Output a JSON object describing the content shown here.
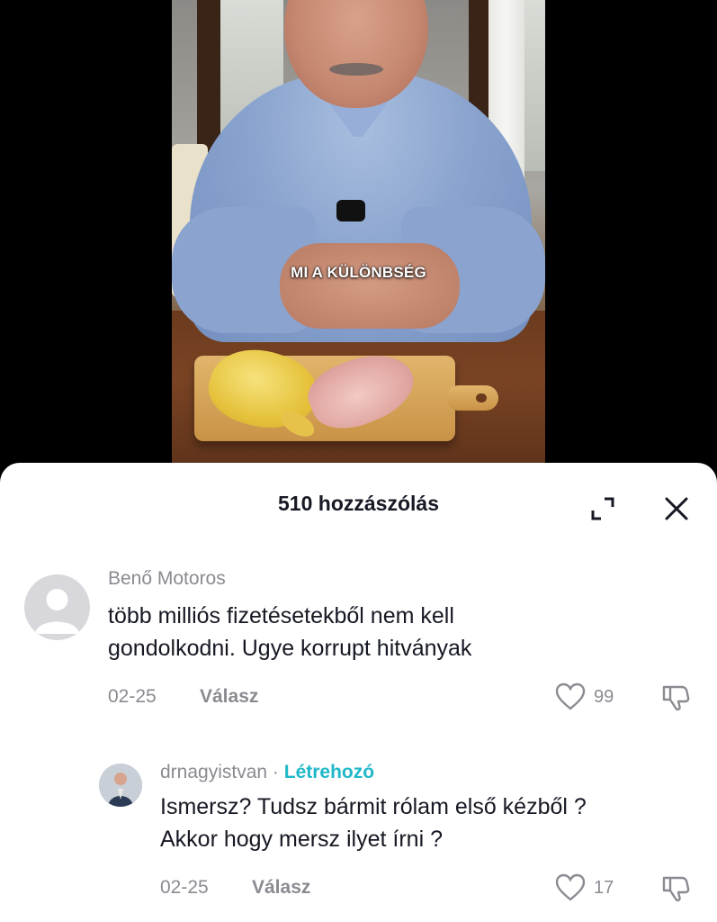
{
  "video": {
    "caption": "MI A KÜLÖNBSÉG"
  },
  "sheet": {
    "title": "510 hozzászólás",
    "icons": {
      "expand": "expand-icon",
      "close": "close-icon"
    }
  },
  "comments": [
    {
      "username": "Benő Motoros",
      "text_line1": "több milliós fizetésetekből nem kell",
      "text_line2": "gondolkodni. Ugye korrupt hitványak",
      "date": "02-25",
      "reply_label": "Válasz",
      "likes": "99",
      "avatar": "default-avatar"
    },
    {
      "username": "drnagyistvan",
      "separator": " · ",
      "badge": "Létrehozó",
      "text_line1": "Ismersz? Tudsz bármit rólam első kézből ?",
      "text_line2": "Akkor hogy mersz ilyet írni ?",
      "date": "02-25",
      "reply_label": "Válasz",
      "likes": "17",
      "avatar": "profile-photo"
    }
  ],
  "colors": {
    "creator_badge": "#20b8c9",
    "muted_text": "#8a8b91",
    "primary_text": "#161823"
  }
}
